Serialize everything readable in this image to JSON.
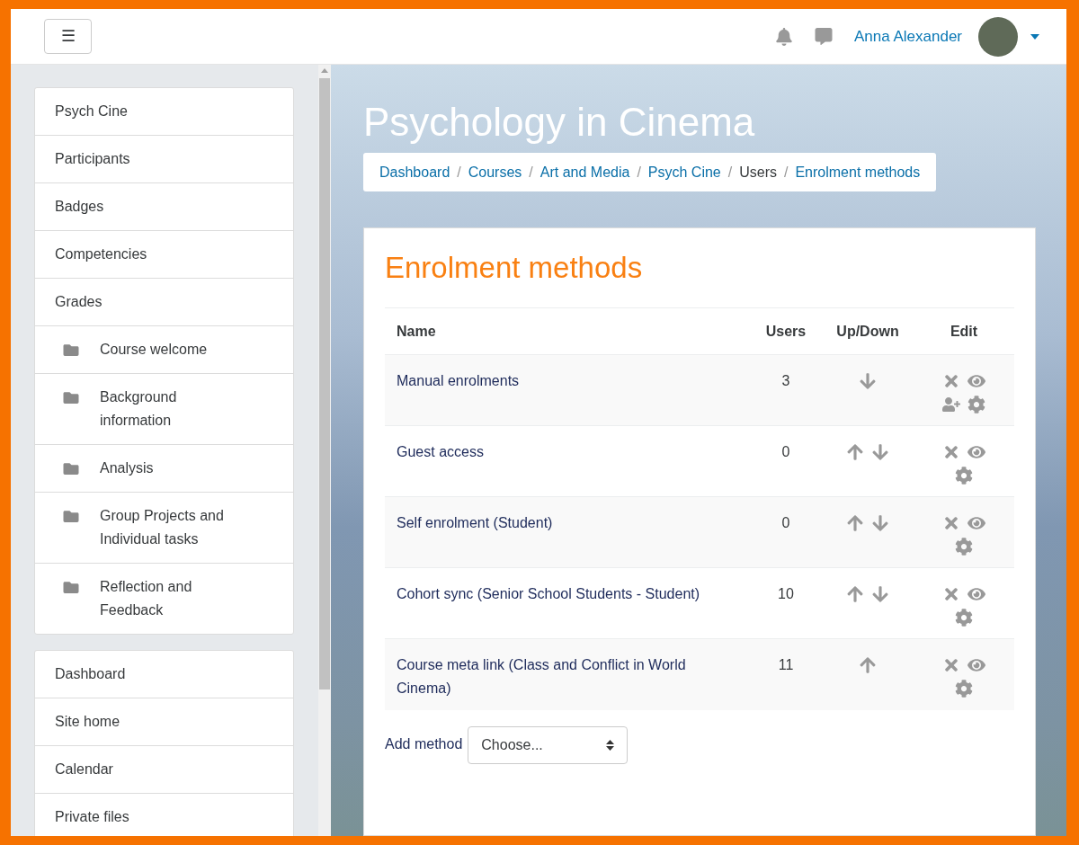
{
  "header": {
    "menu_button": "☰",
    "user_name": "Anna Alexander"
  },
  "sidebar": {
    "course_items": [
      {
        "kind": "link",
        "label": "Psych Cine"
      },
      {
        "kind": "link",
        "label": "Participants"
      },
      {
        "kind": "link",
        "label": "Badges"
      },
      {
        "kind": "link",
        "label": "Competencies"
      },
      {
        "kind": "link",
        "label": "Grades"
      },
      {
        "kind": "section",
        "label": "Course welcome"
      },
      {
        "kind": "section",
        "label": "Background information"
      },
      {
        "kind": "section",
        "label": "Analysis"
      },
      {
        "kind": "section",
        "label": "Group Projects and Individual tasks"
      },
      {
        "kind": "section",
        "label": "Reflection and Feedback"
      }
    ],
    "site_items": [
      {
        "label": "Dashboard"
      },
      {
        "label": "Site home"
      },
      {
        "label": "Calendar"
      },
      {
        "label": "Private files"
      }
    ]
  },
  "breadcrumb_separator": "/",
  "page_title": "Psychology in Cinema",
  "breadcrumb": [
    {
      "label": "Dashboard",
      "link": true
    },
    {
      "label": "Courses",
      "link": true
    },
    {
      "label": "Art and Media",
      "link": true
    },
    {
      "label": "Psych Cine",
      "link": true
    },
    {
      "label": "Users",
      "link": false
    },
    {
      "label": "Enrolment methods",
      "link": true
    }
  ],
  "heading": "Enrolment methods",
  "table": {
    "columns": [
      "Name",
      "Users",
      "Up/Down",
      "Edit"
    ],
    "rows": [
      {
        "name": "Manual enrolments",
        "users": "3",
        "move_up": false,
        "move_down": true,
        "enrol_users": true
      },
      {
        "name": "Guest access",
        "users": "0",
        "move_up": true,
        "move_down": true,
        "enrol_users": false
      },
      {
        "name": "Self enrolment (Student)",
        "users": "0",
        "move_up": true,
        "move_down": true,
        "enrol_users": false
      },
      {
        "name": "Cohort sync (Senior School Students - Student)",
        "users": "10",
        "move_up": true,
        "move_down": true,
        "enrol_users": false
      },
      {
        "name": "Course meta link (Class and Conflict in World Cinema)",
        "users": "11",
        "move_up": true,
        "move_down": false,
        "enrol_users": false
      }
    ]
  },
  "add_method": {
    "label": "Add method",
    "value": "Choose..."
  }
}
